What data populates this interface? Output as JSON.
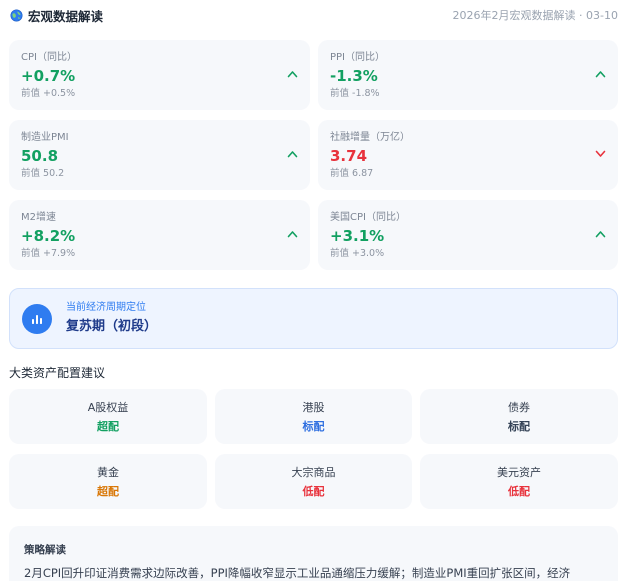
{
  "header": {
    "title": "宏观数据解读",
    "meta": "2026年2月宏观数据解读 · 03-10"
  },
  "indicators": [
    {
      "label": "CPI（同比）",
      "value": "+0.7%",
      "prev": "前值 +0.5%",
      "trend": "up"
    },
    {
      "label": "PPI（同比）",
      "value": "-1.3%",
      "prev": "前值 -1.8%",
      "trend": "up"
    },
    {
      "label": "制造业PMI",
      "value": "50.8",
      "prev": "前值 50.2",
      "trend": "up"
    },
    {
      "label": "社融增量（万亿）",
      "value": "3.74",
      "prev": "前值 6.87",
      "trend": "down"
    },
    {
      "label": "M2增速",
      "value": "+8.2%",
      "prev": "前值 +7.9%",
      "trend": "up"
    },
    {
      "label": "美国CPI（同比）",
      "value": "+3.1%",
      "prev": "前值 +3.0%",
      "trend": "up"
    }
  ],
  "cycle": {
    "label": "当前经济周期定位",
    "value": "复苏期（初段）"
  },
  "allocation": {
    "title": "大类资产配置建议",
    "items": [
      {
        "name": "A股权益",
        "rating": "超配",
        "color": "#12a061"
      },
      {
        "name": "港股",
        "rating": "标配",
        "color": "#2f6fe0"
      },
      {
        "name": "债券",
        "rating": "标配",
        "color": "#334155"
      },
      {
        "name": "黄金",
        "rating": "超配",
        "color": "#d97706"
      },
      {
        "name": "大宗商品",
        "rating": "低配",
        "color": "#e8323c"
      },
      {
        "name": "美元资产",
        "rating": "低配",
        "color": "#e8323c"
      }
    ]
  },
  "strategy": {
    "title": "策略解读",
    "body": "2月CPI回升印证消费需求边际改善，PPI降幅收窄显示工业品通缩压力缓解；制造业PMI重回扩张区间，经济"
  },
  "colors": {
    "up": "#12a061",
    "down": "#e8323c",
    "accent": "#2f7cf0"
  },
  "icons": {
    "header": "globe-icon",
    "cycle": "bar-chart-icon",
    "trend_up": "chevron-up-icon",
    "trend_down": "chevron-down-icon"
  }
}
